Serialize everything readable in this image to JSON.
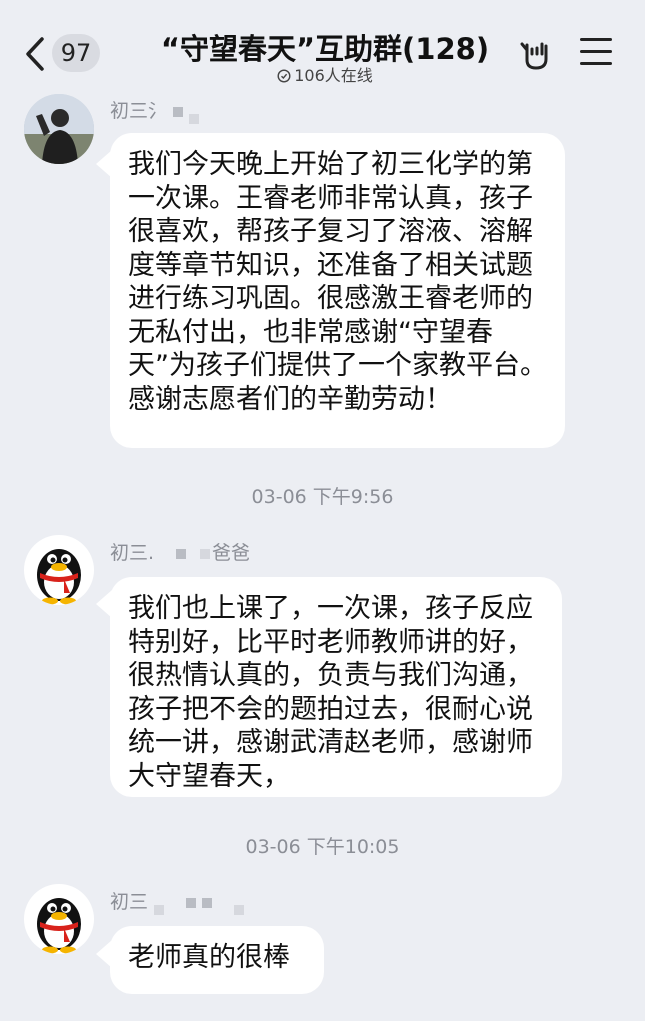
{
  "header": {
    "unread_count": "97",
    "title": "“守望春天”互助群(128)",
    "online_status": "106人在线",
    "icons": [
      "back-chevron-icon",
      "clock-icon",
      "rock-hand-icon",
      "menu-icon"
    ]
  },
  "messages": [
    {
      "sender": "初三氵",
      "avatar": "photo-avatar",
      "text": "我们今天晚上开始了初三化学的第一次课。王睿老师非常认真，孩子很喜欢，帮孩子复习了溶液、溶解度等章节知识，还准备了相关试题进行练习巩固。很感激王睿老师的无私付出，也非常感谢“守望春天”为孩子们提供了一个家教平台。感谢志愿者们的辛勤劳动！"
    },
    {
      "timestamp": "03-06 下午9:56"
    },
    {
      "sender_prefix": "初三.",
      "sender_suffix": "爸爸",
      "avatar": "qq-penguin-avatar",
      "text": "我们也上课了，一次课，孩子反应特别好，比平时老师教师讲的好，很热情认真的，负责与我们沟通，孩子把不会的题拍过去，很耐心说统一讲，感谢武清赵老师，感谢师大守望春天，"
    },
    {
      "timestamp": "03-06 下午10:05"
    },
    {
      "sender": "初三",
      "avatar": "qq-penguin-avatar",
      "text": "老师真的很棒"
    }
  ],
  "colors": {
    "background": "#eceef3",
    "bubble": "#ffffff",
    "meta_text": "#8b8e96"
  }
}
